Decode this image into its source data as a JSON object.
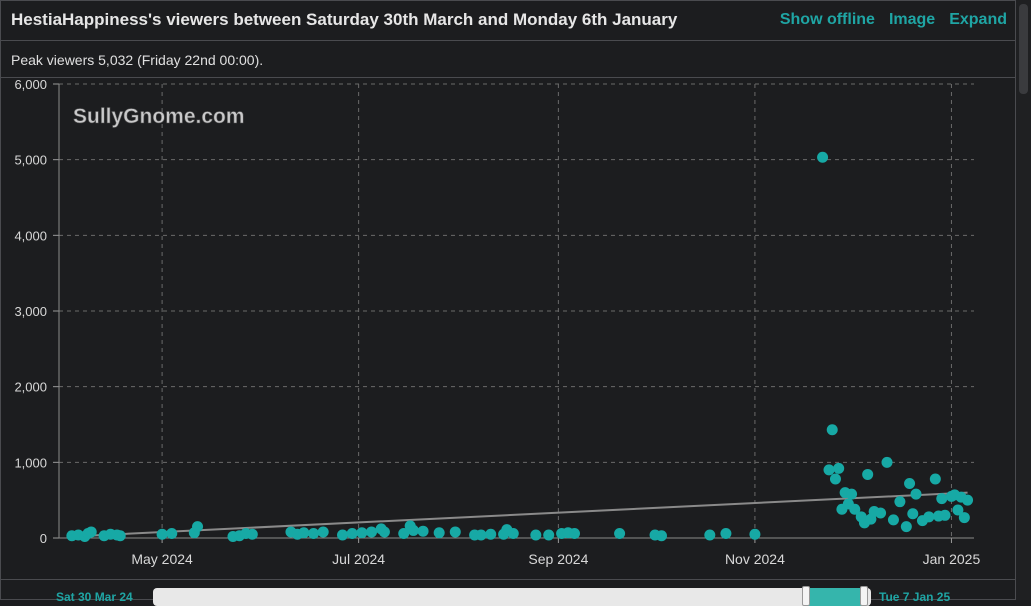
{
  "header": {
    "title": "HestiaHappiness's viewers between Saturday 30th March and Monday 6th January",
    "actions": {
      "show_offline": "Show offline",
      "image": "Image",
      "expand": "Expand"
    }
  },
  "peak_text": "Peak viewers 5,032 (Friday 22nd 00:00).",
  "watermark": "SullyGnome.com",
  "navigator": {
    "start_label": "Sat 30 Mar 24",
    "end_label": "Tue 7 Jan 25",
    "selection": [
      0.91,
      0.99
    ]
  },
  "colors": {
    "accent": "#1fa5a4",
    "point": "#17a9a5",
    "trend": "#8a8a8a",
    "grid": "#6a6a6a"
  },
  "chart_data": {
    "type": "scatter",
    "title": "",
    "xlabel": "",
    "ylabel": "",
    "ylim": [
      0,
      6000
    ],
    "xlim": [
      "2024-03-30",
      "2025-01-08"
    ],
    "y_ticks": [
      "0",
      "1,000",
      "2,000",
      "3,000",
      "4,000",
      "5,000",
      "6,000"
    ],
    "x_ticks": [
      {
        "date": "2024-05-01",
        "label": "May 2024"
      },
      {
        "date": "2024-07-01",
        "label": "Jul 2024"
      },
      {
        "date": "2024-09-01",
        "label": "Sep 2024"
      },
      {
        "date": "2024-11-01",
        "label": "Nov 2024"
      },
      {
        "date": "2025-01-01",
        "label": "Jan 2025"
      }
    ],
    "grid": true,
    "trendline": [
      [
        "2024-04-03",
        20
      ],
      [
        "2025-01-06",
        600
      ]
    ],
    "series": [
      {
        "points": [
          [
            "2024-04-03",
            30
          ],
          [
            "2024-04-05",
            40
          ],
          [
            "2024-04-07",
            20
          ],
          [
            "2024-04-08",
            60
          ],
          [
            "2024-04-09",
            80
          ],
          [
            "2024-04-13",
            30
          ],
          [
            "2024-04-15",
            50
          ],
          [
            "2024-04-17",
            40
          ],
          [
            "2024-04-18",
            30
          ],
          [
            "2024-05-01",
            50
          ],
          [
            "2024-05-04",
            60
          ],
          [
            "2024-05-11",
            70
          ],
          [
            "2024-05-12",
            150
          ],
          [
            "2024-05-23",
            20
          ],
          [
            "2024-05-25",
            30
          ],
          [
            "2024-05-27",
            60
          ],
          [
            "2024-05-29",
            50
          ],
          [
            "2024-06-10",
            80
          ],
          [
            "2024-06-12",
            50
          ],
          [
            "2024-06-14",
            70
          ],
          [
            "2024-06-17",
            60
          ],
          [
            "2024-06-20",
            80
          ],
          [
            "2024-06-26",
            40
          ],
          [
            "2024-06-29",
            60
          ],
          [
            "2024-07-02",
            70
          ],
          [
            "2024-07-05",
            80
          ],
          [
            "2024-07-08",
            120
          ],
          [
            "2024-07-09",
            80
          ],
          [
            "2024-07-15",
            60
          ],
          [
            "2024-07-17",
            160
          ],
          [
            "2024-07-18",
            100
          ],
          [
            "2024-07-21",
            90
          ],
          [
            "2024-07-26",
            70
          ],
          [
            "2024-07-31",
            80
          ],
          [
            "2024-08-06",
            40
          ],
          [
            "2024-08-08",
            40
          ],
          [
            "2024-08-11",
            50
          ],
          [
            "2024-08-15",
            50
          ],
          [
            "2024-08-16",
            110
          ],
          [
            "2024-08-18",
            60
          ],
          [
            "2024-08-25",
            40
          ],
          [
            "2024-08-29",
            40
          ],
          [
            "2024-09-02",
            60
          ],
          [
            "2024-09-04",
            70
          ],
          [
            "2024-09-06",
            60
          ],
          [
            "2024-09-20",
            60
          ],
          [
            "2024-10-01",
            40
          ],
          [
            "2024-10-03",
            30
          ],
          [
            "2024-10-18",
            40
          ],
          [
            "2024-10-23",
            60
          ],
          [
            "2024-11-01",
            50
          ],
          [
            "2024-11-22",
            5032
          ],
          [
            "2024-11-24",
            900
          ],
          [
            "2024-11-25",
            1430
          ],
          [
            "2024-11-26",
            780
          ],
          [
            "2024-11-27",
            920
          ],
          [
            "2024-11-28",
            380
          ],
          [
            "2024-11-29",
            600
          ],
          [
            "2024-11-30",
            450
          ],
          [
            "2024-12-01",
            580
          ],
          [
            "2024-12-02",
            380
          ],
          [
            "2024-12-04",
            280
          ],
          [
            "2024-12-05",
            200
          ],
          [
            "2024-12-06",
            840
          ],
          [
            "2024-12-07",
            250
          ],
          [
            "2024-12-08",
            350
          ],
          [
            "2024-12-10",
            330
          ],
          [
            "2024-12-12",
            1000
          ],
          [
            "2024-12-14",
            240
          ],
          [
            "2024-12-16",
            480
          ],
          [
            "2024-12-18",
            150
          ],
          [
            "2024-12-19",
            720
          ],
          [
            "2024-12-20",
            320
          ],
          [
            "2024-12-21",
            580
          ],
          [
            "2024-12-23",
            230
          ],
          [
            "2024-12-25",
            280
          ],
          [
            "2024-12-27",
            780
          ],
          [
            "2024-12-28",
            290
          ],
          [
            "2024-12-29",
            520
          ],
          [
            "2024-12-30",
            300
          ],
          [
            "2025-01-01",
            550
          ],
          [
            "2025-01-02",
            570
          ],
          [
            "2025-01-03",
            370
          ],
          [
            "2025-01-04",
            540
          ],
          [
            "2025-01-05",
            270
          ],
          [
            "2025-01-06",
            500
          ]
        ]
      }
    ]
  }
}
